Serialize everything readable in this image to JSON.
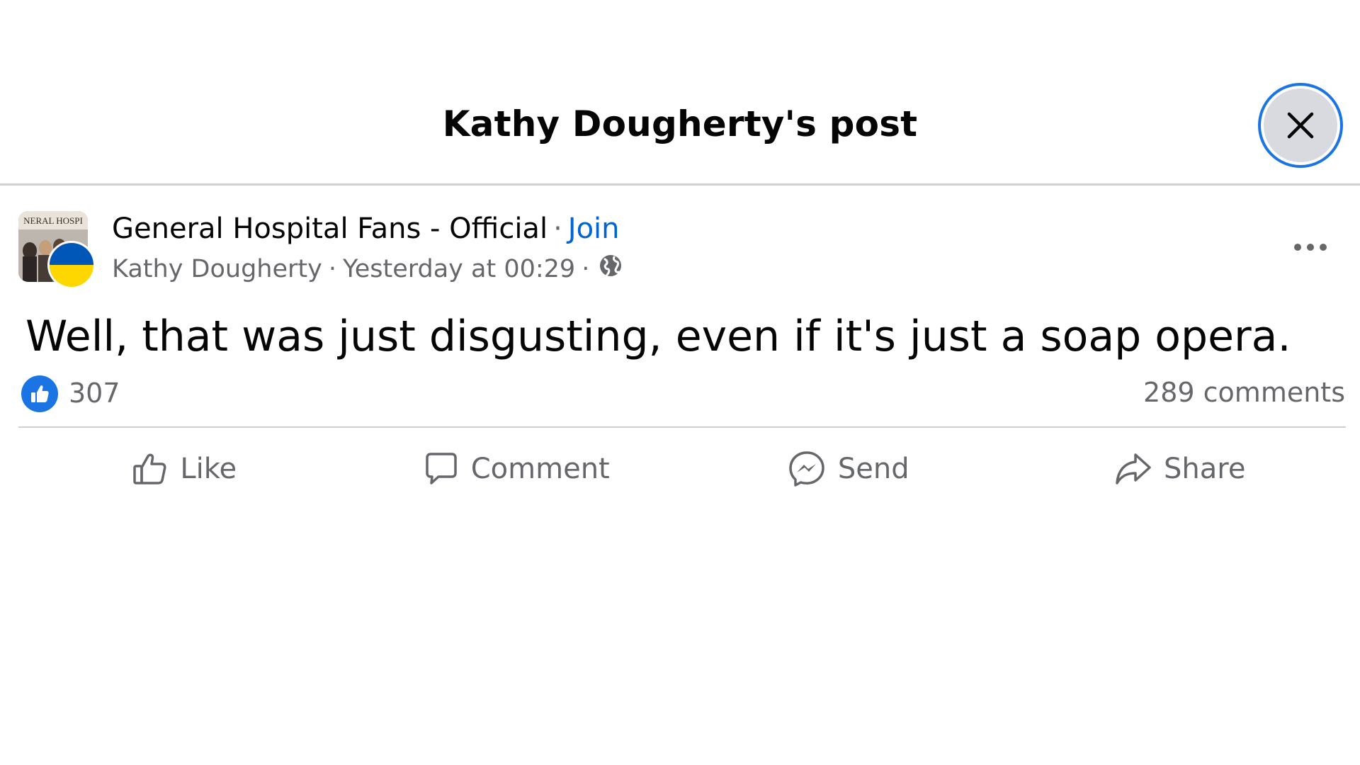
{
  "dialog": {
    "title": "Kathy Dougherty's post",
    "close_icon": "close-icon"
  },
  "post": {
    "group_name": "General Hospital Fans - Official",
    "separator": "·",
    "join_label": "Join",
    "author": "Kathy Dougherty",
    "timestamp": "Yesterday at 00:29",
    "audience_icon": "globe-icon",
    "more_icon": "more-options-icon",
    "avatar_caption": "NERAL HOSPI",
    "text": "Well, that was just disgusting, even if it's just a soap opera."
  },
  "stats": {
    "reaction_icon": "like-reaction-icon",
    "reaction_count": "307",
    "comments": "289 comments"
  },
  "actions": {
    "like": "Like",
    "comment": "Comment",
    "send": "Send",
    "share": "Share"
  },
  "colors": {
    "accent": "#1b74e4",
    "link": "#0064d1",
    "secondary_text": "#65676b",
    "divider": "#ced0d4",
    "flag_blue": "#0057b7",
    "flag_yellow": "#ffd700"
  }
}
